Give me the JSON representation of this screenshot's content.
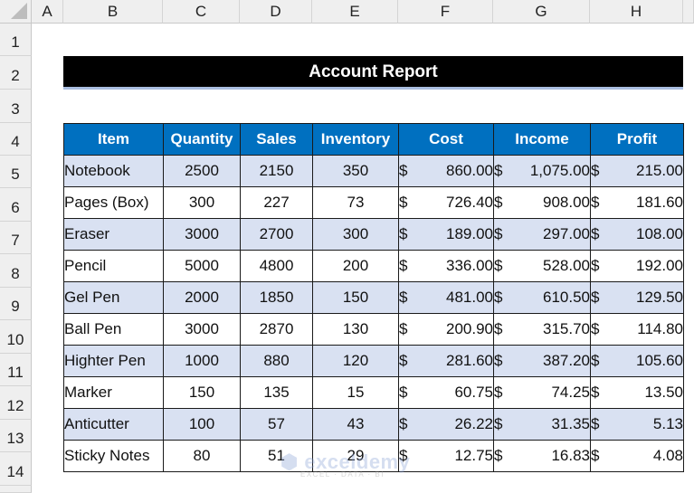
{
  "sheet": {
    "columns": [
      "A",
      "B",
      "C",
      "D",
      "E",
      "F",
      "G",
      "H"
    ],
    "rows": [
      "1",
      "2",
      "3",
      "4",
      "5",
      "6",
      "7",
      "8",
      "9",
      "10",
      "11",
      "12",
      "13",
      "14"
    ]
  },
  "report": {
    "title": "Account Report",
    "headers": [
      "Item",
      "Quantity",
      "Sales",
      "Inventory",
      "Cost",
      "Income",
      "Profit"
    ],
    "currency_symbol": "$",
    "rows": [
      {
        "item": "Notebook",
        "quantity": "2500",
        "sales": "2150",
        "inventory": "350",
        "cost": "860.00",
        "income": "1,075.00",
        "profit": "215.00"
      },
      {
        "item": "Pages (Box)",
        "quantity": "300",
        "sales": "227",
        "inventory": "73",
        "cost": "726.40",
        "income": "908.00",
        "profit": "181.60"
      },
      {
        "item": "Eraser",
        "quantity": "3000",
        "sales": "2700",
        "inventory": "300",
        "cost": "189.00",
        "income": "297.00",
        "profit": "108.00"
      },
      {
        "item": "Pencil",
        "quantity": "5000",
        "sales": "4800",
        "inventory": "200",
        "cost": "336.00",
        "income": "528.00",
        "profit": "192.00"
      },
      {
        "item": "Gel Pen",
        "quantity": "2000",
        "sales": "1850",
        "inventory": "150",
        "cost": "481.00",
        "income": "610.50",
        "profit": "129.50"
      },
      {
        "item": "Ball Pen",
        "quantity": "3000",
        "sales": "2870",
        "inventory": "130",
        "cost": "200.90",
        "income": "315.70",
        "profit": "114.80"
      },
      {
        "item": "Highter Pen",
        "quantity": "1000",
        "sales": "880",
        "inventory": "120",
        "cost": "281.60",
        "income": "387.20",
        "profit": "105.60"
      },
      {
        "item": "Marker",
        "quantity": "150",
        "sales": "135",
        "inventory": "15",
        "cost": "60.75",
        "income": "74.25",
        "profit": "13.50"
      },
      {
        "item": "Anticutter",
        "quantity": "100",
        "sales": "57",
        "inventory": "43",
        "cost": "26.22",
        "income": "31.35",
        "profit": "5.13"
      },
      {
        "item": "Sticky Notes",
        "quantity": "80",
        "sales": "51",
        "inventory": "29",
        "cost": "12.75",
        "income": "16.83",
        "profit": "4.08"
      }
    ]
  },
  "watermark": {
    "name": "exceldemy",
    "tagline": "EXCEL · DATA · BI"
  },
  "colors": {
    "header_blue": "#0070c0",
    "band": "#d9e1f2",
    "title_bg": "#000000"
  }
}
